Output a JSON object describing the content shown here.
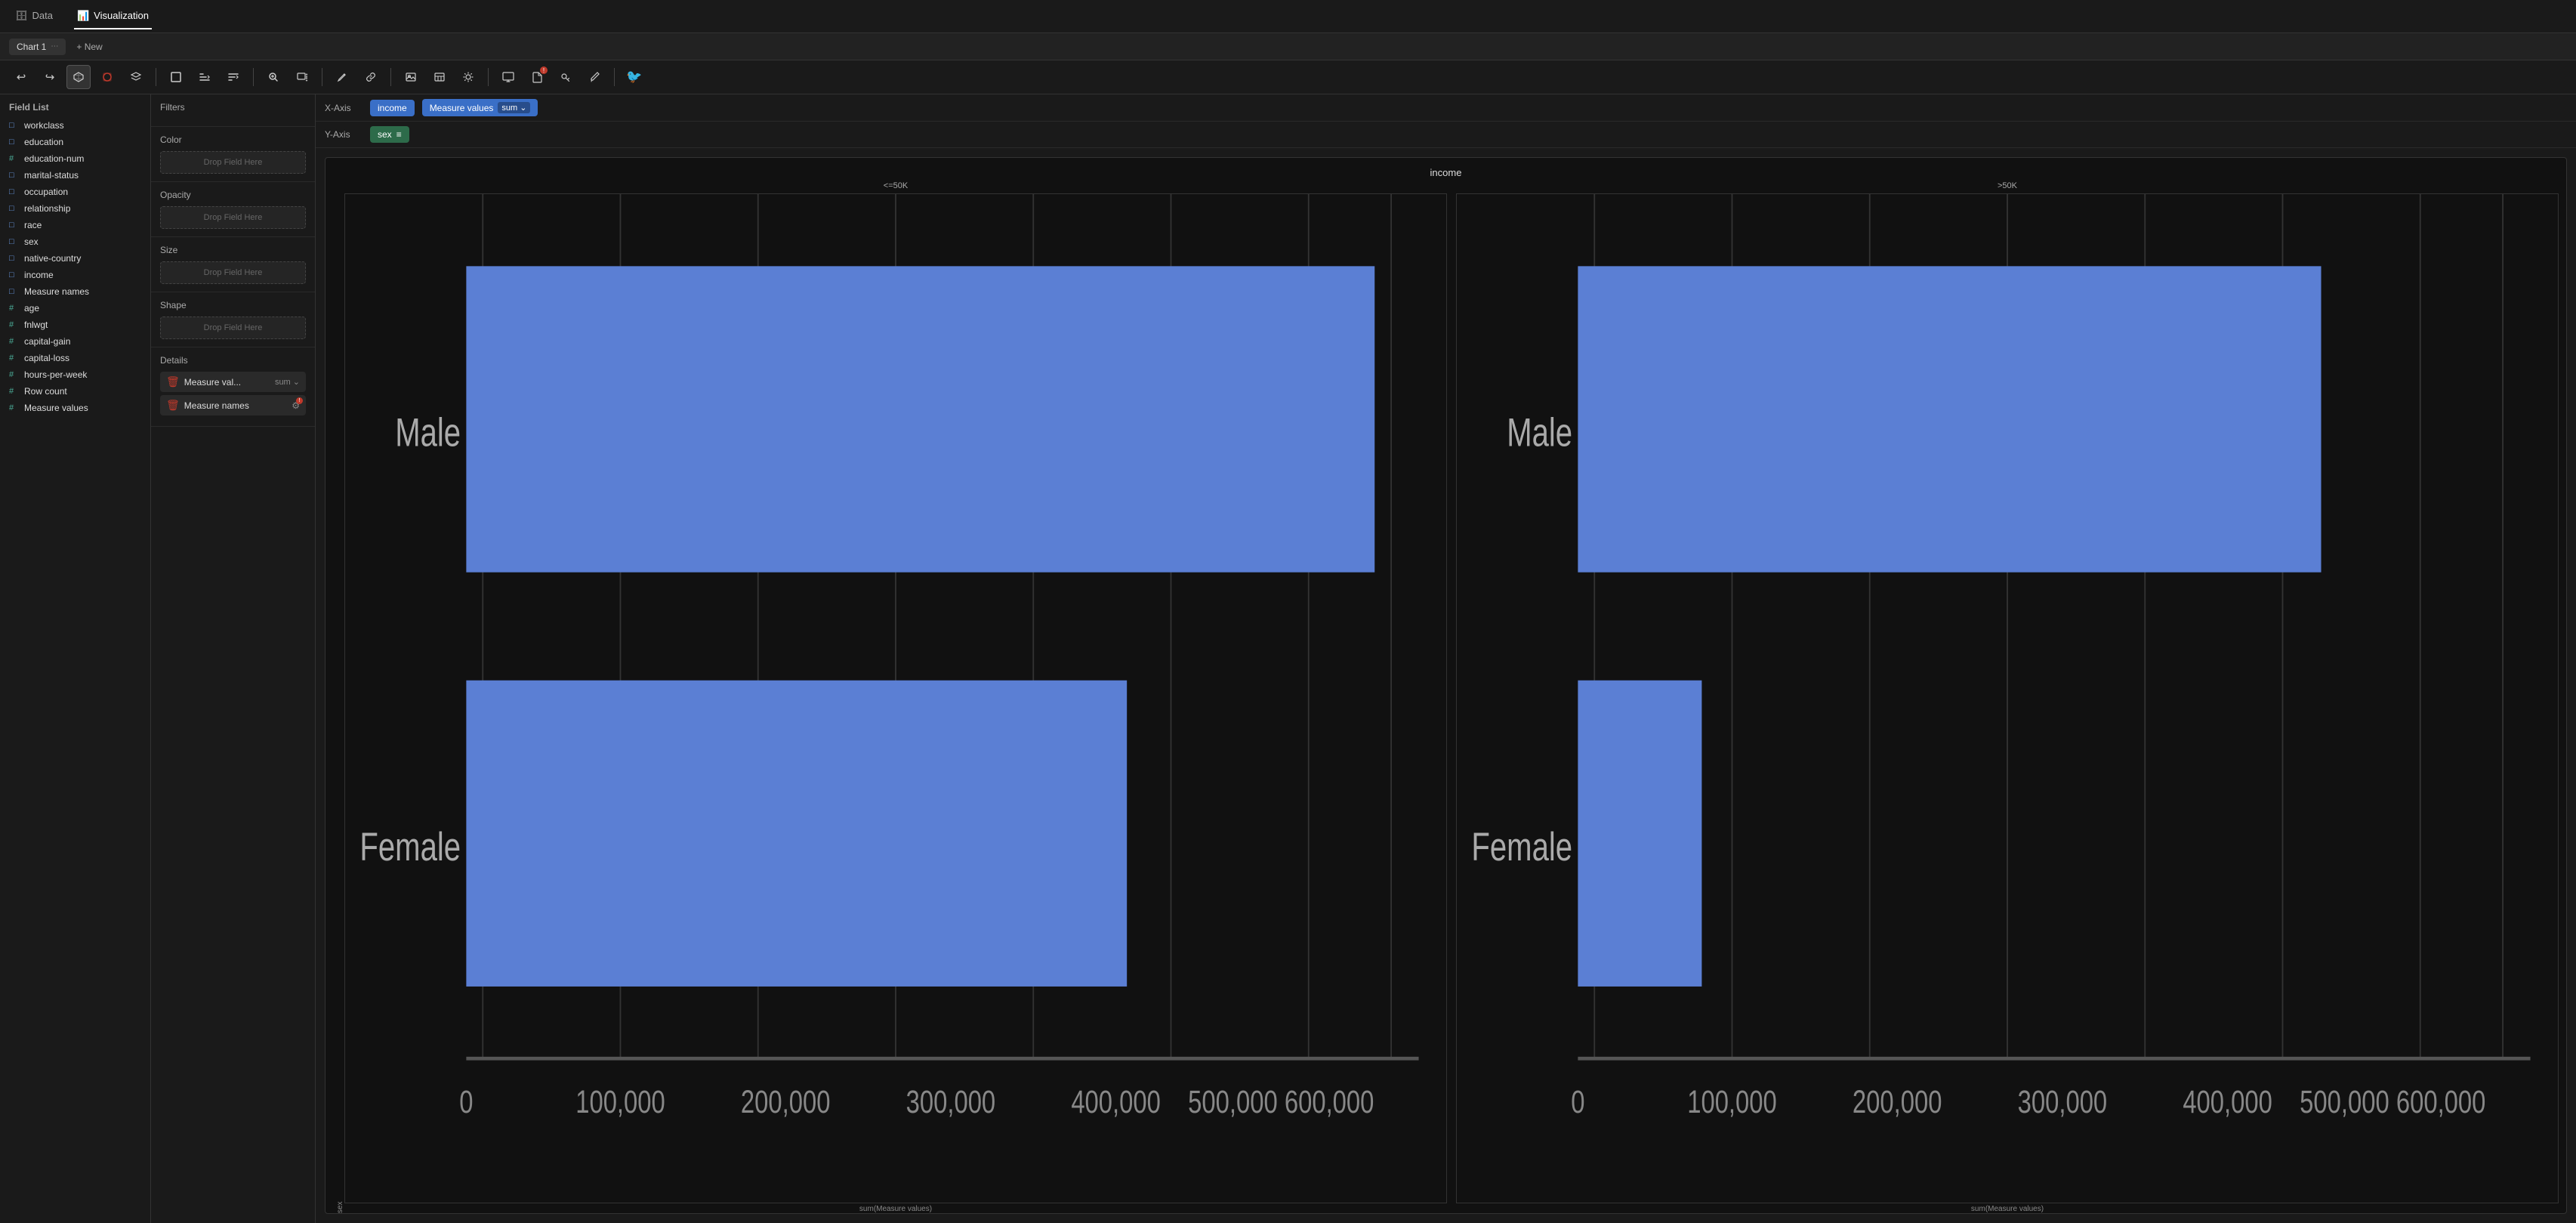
{
  "nav": {
    "data_label": "Data",
    "visualization_label": "Visualization",
    "active_tab": "Visualization"
  },
  "tabs": {
    "chart1_label": "Chart 1",
    "new_label": "+ New"
  },
  "toolbar": {
    "undo_label": "↩",
    "redo_label": "↪",
    "buttons": [
      "cube",
      "paint",
      "layers",
      "rect",
      "sort-asc",
      "sort-desc",
      "zoom-in",
      "resize",
      "pen",
      "link",
      "image",
      "table",
      "settings",
      "screen",
      "doc",
      "key",
      "brush",
      "bird"
    ]
  },
  "field_list": {
    "header": "Field List",
    "string_fields": [
      {
        "name": "workclass",
        "type": "string"
      },
      {
        "name": "education",
        "type": "string"
      },
      {
        "name": "marital-status",
        "type": "string"
      },
      {
        "name": "occupation",
        "type": "string"
      },
      {
        "name": "relationship",
        "type": "string"
      },
      {
        "name": "race",
        "type": "string"
      },
      {
        "name": "sex",
        "type": "string"
      },
      {
        "name": "native-country",
        "type": "string"
      },
      {
        "name": "income",
        "type": "string"
      },
      {
        "name": "Measure names",
        "type": "string"
      }
    ],
    "numeric_fields": [
      {
        "name": "age",
        "type": "number"
      },
      {
        "name": "fnlwgt",
        "type": "number"
      },
      {
        "name": "education-num",
        "type": "number"
      },
      {
        "name": "capital-gain",
        "type": "number"
      },
      {
        "name": "capital-loss",
        "type": "number"
      },
      {
        "name": "hours-per-week",
        "type": "number"
      },
      {
        "name": "Row count",
        "type": "number"
      },
      {
        "name": "Measure values",
        "type": "number"
      }
    ]
  },
  "filters": {
    "section_label": "Filters"
  },
  "color": {
    "section_label": "Color",
    "drop_label": "Drop Field Here"
  },
  "opacity": {
    "section_label": "Opacity",
    "drop_label": "Drop Field Here"
  },
  "size": {
    "section_label": "Size",
    "drop_label": "Drop Field Here"
  },
  "shape": {
    "section_label": "Shape",
    "drop_label": "Drop Field Here"
  },
  "details": {
    "section_label": "Details",
    "pills": [
      {
        "label": "Measure val...",
        "agg": "sum",
        "has_agg": true
      },
      {
        "label": "Measure names",
        "has_settings": true
      }
    ]
  },
  "axes": {
    "x_label": "X-Axis",
    "y_label": "Y-Axis",
    "x_field": "income",
    "x_measure": "Measure values",
    "x_agg": "sum",
    "y_field": "sex",
    "y_icon": "≡"
  },
  "chart": {
    "title": "income",
    "y_axis_label": "sex",
    "left_panel_title": "<=50K",
    "right_panel_title": ">50K",
    "x_axis_label": "sum(Measure values)",
    "y_labels": [
      "Male",
      "Female"
    ],
    "x_ticks": [
      "0",
      "100,000",
      "200,000",
      "300,000",
      "400,000",
      "500,000 600,000"
    ],
    "bars_left": [
      {
        "label": "Male",
        "width_pct": 88,
        "color": "#5b7fd4"
      },
      {
        "label": "Female",
        "width_pct": 65,
        "color": "#5b7fd4"
      }
    ],
    "bars_right": [
      {
        "label": "Male",
        "width_pct": 72,
        "color": "#5b7fd4"
      },
      {
        "label": "Female",
        "width_pct": 12,
        "color": "#5b7fd4"
      }
    ]
  }
}
